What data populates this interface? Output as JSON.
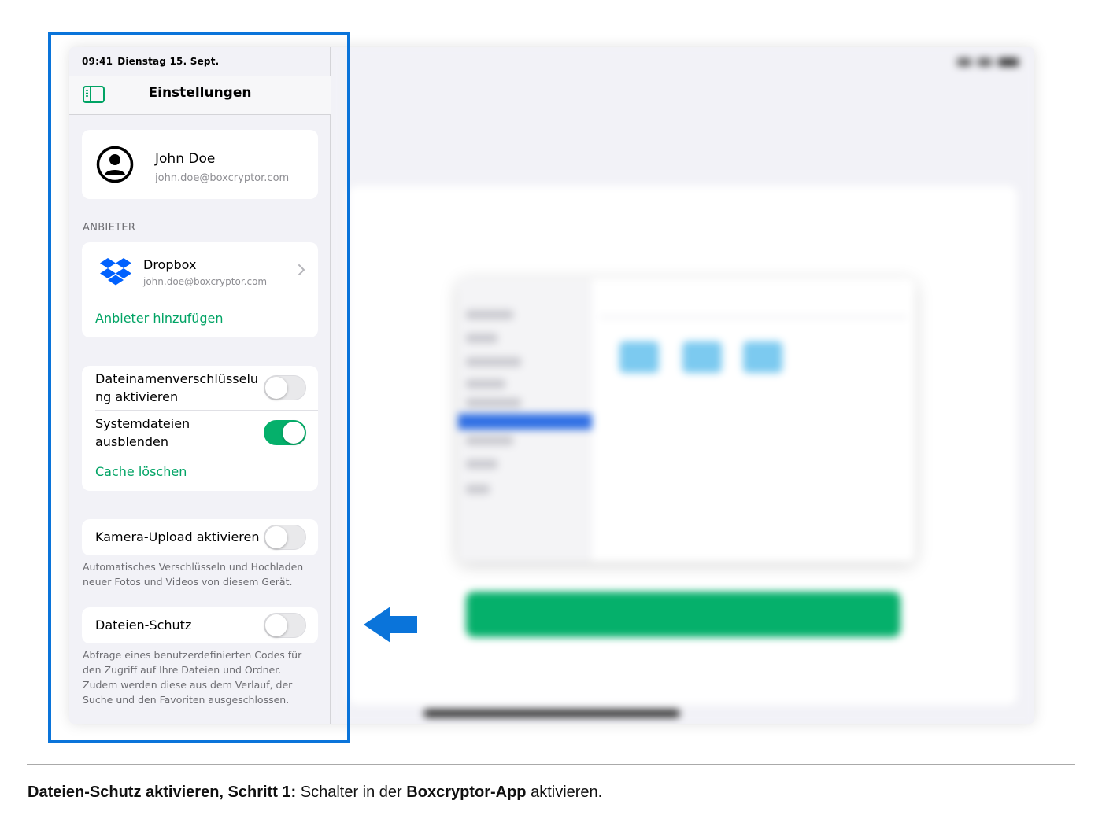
{
  "status_bar": {
    "time": "09:41",
    "date": "Dienstag 15. Sept."
  },
  "nav": {
    "title": "Einstellungen"
  },
  "profile": {
    "name": "John Doe",
    "email": "john.doe@boxcryptor.com"
  },
  "providers_section": {
    "header": "ANBIETER",
    "items": [
      {
        "name": "Dropbox",
        "email": "john.doe@boxcryptor.com"
      }
    ],
    "add_label": "Anbieter hinzufügen"
  },
  "file_settings": {
    "filename_encryption": {
      "label_line1": "Dateinamenverschlüsselu",
      "label_line2": "ng aktivieren",
      "enabled": false
    },
    "hide_system_files": {
      "label_line1": "Systemdateien",
      "label_line2": "ausblenden",
      "enabled": true
    },
    "clear_cache_label": "Cache löschen"
  },
  "camera_upload": {
    "label": "Kamera-Upload aktivieren",
    "enabled": false,
    "footnote": "Automatisches Verschlüsseln und Hochladen neuer Fotos und Videos von diesem Gerät."
  },
  "file_protection": {
    "label": "Dateien-Schutz",
    "enabled": false,
    "footnote": "Abfrage eines benutzerdefinierten Codes für den Zugriff auf Ihre Dateien und Ordner. Zudem werden diese aus dem Verlauf, der Suche und den Favoriten ausgeschlossen."
  },
  "caption": {
    "bold_prefix": "Dateien-Schutz aktivieren, Schritt 1:",
    "text_mid": " Schalter in der ",
    "bold_app": "Boxcryptor-App",
    "text_end": " aktivieren."
  },
  "colors": {
    "accent_green": "#05b06b",
    "link_green": "#00a364",
    "annotation_blue": "#0a74da",
    "dropbox_blue": "#0061fe"
  },
  "icons": {
    "sidebar_toggle": "sidebar-toggle-icon",
    "avatar": "person-circle-icon",
    "provider": "dropbox-logo-icon",
    "chevron": "chevron-right-icon",
    "annotation": "arrow-left-icon"
  }
}
